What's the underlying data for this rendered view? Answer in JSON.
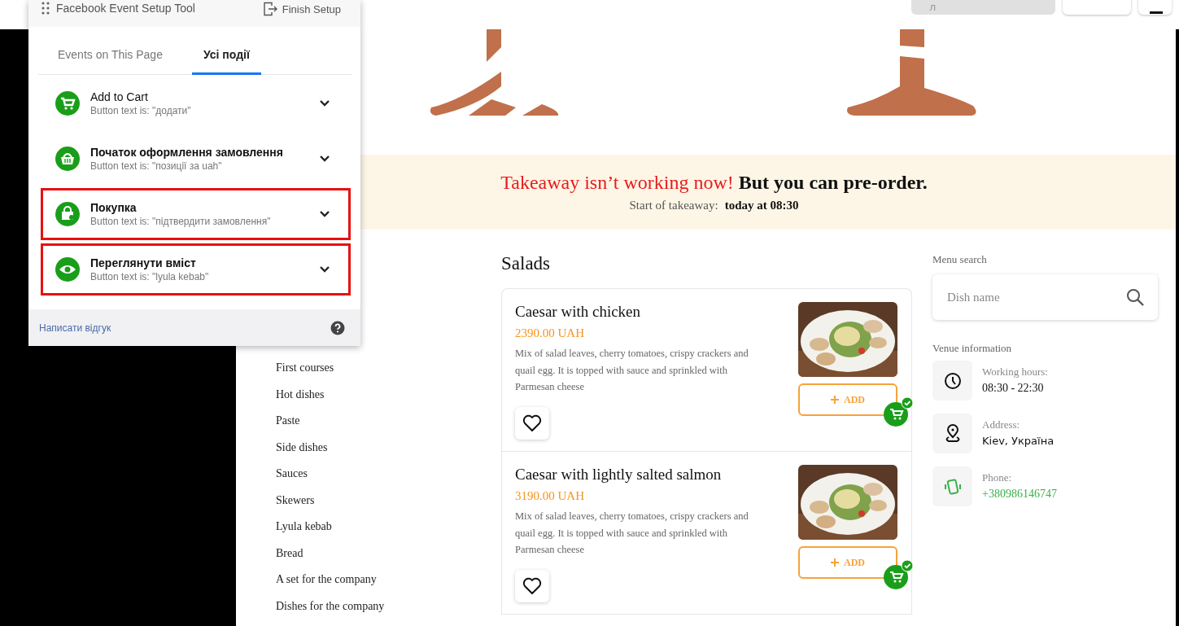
{
  "header": {
    "search_value": "л"
  },
  "tool": {
    "title": "Facebook Event Setup Tool",
    "finish": "Finish Setup",
    "tabs": [
      {
        "label": "Events on This Page",
        "selected": false
      },
      {
        "label": "Усі події",
        "selected": true
      }
    ],
    "events": [
      {
        "kind": "cart",
        "name": "Add to Cart",
        "button_text": "Button text is: \"додати\"",
        "highlighted": false
      },
      {
        "kind": "basket",
        "name": "Початок оформлення замовлення",
        "button_text": "Button text is: \"позиції за uah\"",
        "highlighted": false
      },
      {
        "kind": "bag",
        "name": "Покупка",
        "button_text": "Button text is: \"підтвердити замовлення\"",
        "highlighted": true
      },
      {
        "kind": "eye",
        "name": "Переглянути вміст",
        "button_text": "Button text is: \"lyula kebab\"",
        "highlighted": true
      }
    ],
    "feedback": "Написати відгук"
  },
  "banner": {
    "alert": "Takeaway isn’t working now!",
    "message": "But you can pre-order.",
    "start_label": "Start of takeaway:",
    "start_value": "today at 08:30"
  },
  "categories": [
    "First courses",
    "Hot dishes",
    "Paste",
    "Side dishes",
    "Sauces",
    "Skewers",
    "Lyula kebab",
    "Bread",
    "A set for the company",
    "Dishes for the company"
  ],
  "section_title": "Salads",
  "dishes": [
    {
      "name": "Caesar with chicken",
      "price": "2390.00 UAH",
      "description": "Mix of salad leaves, cherry tomatoes, crispy crackers and quail egg. It is topped with sauce and sprinkled with Parmesan cheese",
      "add": "ADD",
      "added": true,
      "favorite": false
    },
    {
      "name": "Caesar with lightly salted salmon",
      "price": "3190.00 UAH",
      "description": "Mix of salad leaves, cherry tomatoes, crispy crackers and quail egg. It is topped with sauce and sprinkled with Parmesan cheese",
      "add": "ADD",
      "added": true,
      "favorite": false
    }
  ],
  "search": {
    "label": "Menu search",
    "placeholder": "Dish name"
  },
  "venue": {
    "title": "Venue information",
    "items": [
      {
        "kind": "hours",
        "label": "Working hours:",
        "value": "08:30 - 22:30"
      },
      {
        "kind": "address",
        "label": "Address:",
        "value": "Kiev, Україна"
      },
      {
        "kind": "phone",
        "label": "Phone:",
        "value": "+380986146747"
      }
    ]
  }
}
